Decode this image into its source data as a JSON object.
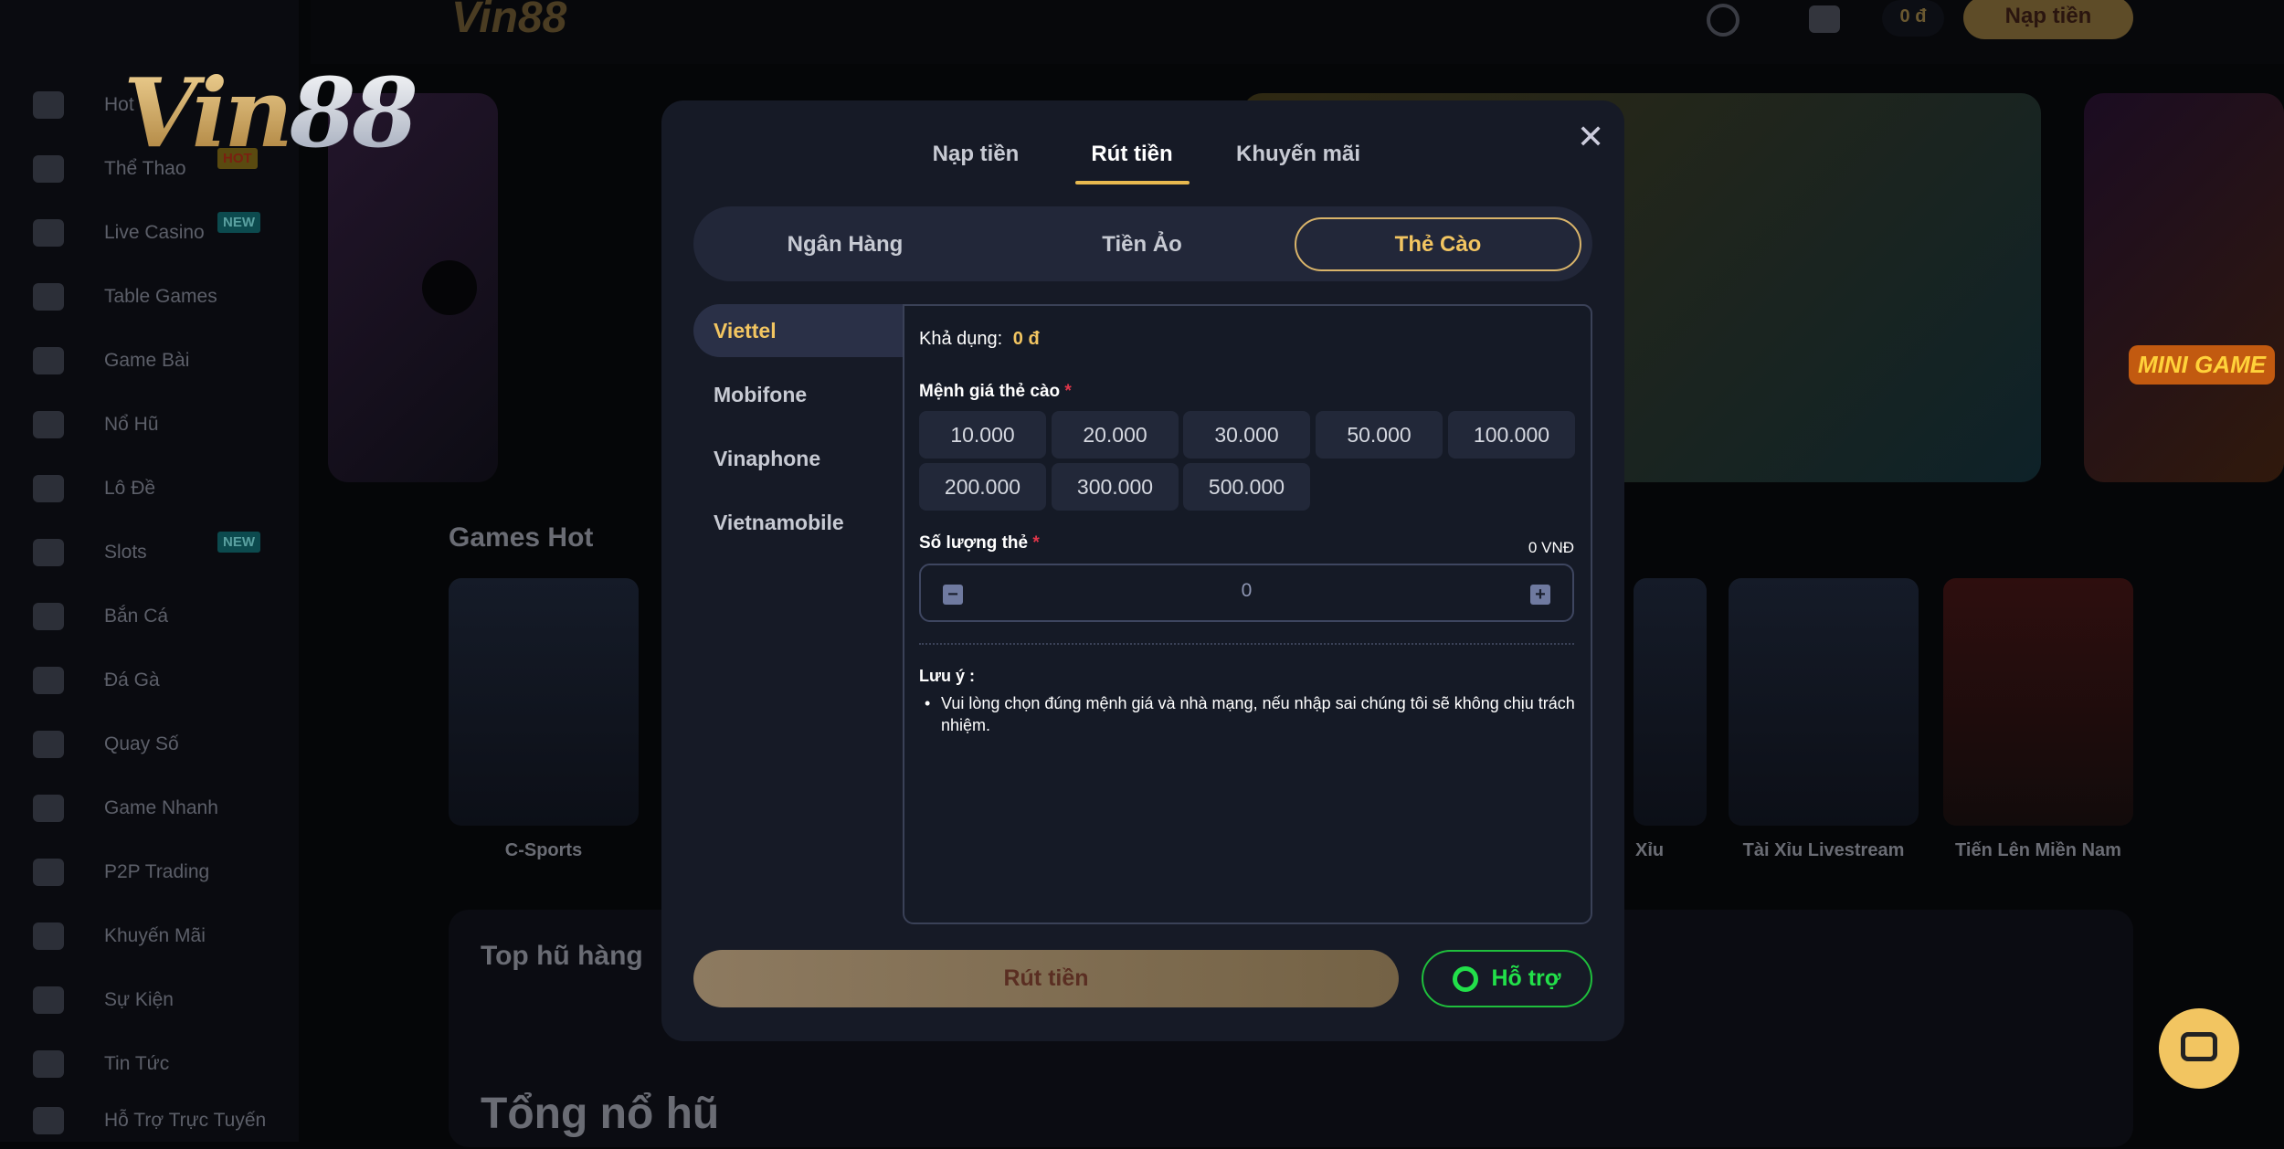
{
  "sidebar": {
    "items": [
      {
        "label": "Hot"
      },
      {
        "label": "Thể Thao",
        "badge": "HOT"
      },
      {
        "label": "Live Casino",
        "badge": "NEW"
      },
      {
        "label": "Table Games"
      },
      {
        "label": "Game Bài"
      },
      {
        "label": "Nổ Hũ"
      },
      {
        "label": "Lô Đề"
      },
      {
        "label": "Slots",
        "badge": "NEW"
      },
      {
        "label": "Bắn Cá"
      },
      {
        "label": "Đá Gà"
      },
      {
        "label": "Quay Số"
      },
      {
        "label": "Game Nhanh"
      },
      {
        "label": "P2P Trading"
      },
      {
        "label": "Khuyến Mãi"
      },
      {
        "label": "Sự Kiện"
      },
      {
        "label": "Tin Tức"
      }
    ],
    "support_label": "Hỗ Trợ Trực Tuyến"
  },
  "logo": {
    "part1": "Vin",
    "part2": "88"
  },
  "header": {
    "balance": "0 đ",
    "deposit_label": "Nạp tiền"
  },
  "page": {
    "games_hot_title": "Games Hot",
    "games": [
      {
        "label": "C-Sports"
      },
      {
        "label": "Xỉu"
      },
      {
        "label": "Tài Xỉu Livestream"
      },
      {
        "label": "Tiến Lên Miền Nam"
      }
    ],
    "jackpot_title": "Top hũ hàng",
    "jackpot_total": "Tổng nổ hũ",
    "mini_game": "MINI GAME"
  },
  "modal": {
    "tabs": [
      {
        "label": "Nạp tiền"
      },
      {
        "label": "Rút tiền",
        "active": true
      },
      {
        "label": "Khuyến mãi"
      }
    ],
    "methods": [
      {
        "label": "Ngân Hàng"
      },
      {
        "label": "Tiền Ảo"
      },
      {
        "label": "Thẻ Cào",
        "active": true
      }
    ],
    "carriers": [
      {
        "label": "Viettel",
        "active": true
      },
      {
        "label": "Mobifone"
      },
      {
        "label": "Vinaphone"
      },
      {
        "label": "Vietnamobile"
      }
    ],
    "available_label": "Khả dụng:",
    "available_value": "0 đ",
    "denomination_label": "Mệnh giá thẻ cào",
    "denominations": [
      "10.000",
      "20.000",
      "30.000",
      "50.000",
      "100.000",
      "200.000",
      "300.000",
      "500.000"
    ],
    "quantity_label": "Số lượng thẻ",
    "total": "0 VNĐ",
    "quantity_value": "0",
    "required_mark": "*",
    "note_title": "Lưu ý :",
    "notes": [
      "Vui lòng chọn đúng mệnh giá và nhà mạng, nếu nhập sai chúng tôi sẽ không chịu trách nhiệm."
    ],
    "submit_label": "Rút tiền",
    "support_label": "Hỗ trợ"
  },
  "colors": {
    "accent": "#f2c561",
    "support": "#22e04a",
    "required": "#e0364a",
    "modal_bg": "#161a26"
  }
}
